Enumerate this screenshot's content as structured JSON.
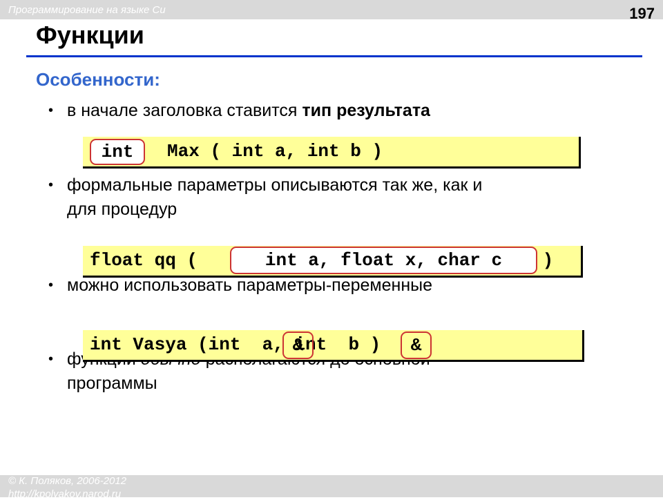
{
  "header": {
    "course": "Программирование на языке Си",
    "page_number": "197"
  },
  "title": "Функции",
  "subtitle": "Особенности:",
  "bullets": [
    {
      "text": "в начале заголовка ставится ",
      "bold": "тип результата"
    },
    {
      "line1": "формальные параметры описываются так же, как и",
      "line2": "для процедур"
    },
    {
      "text": "можно использовать параметры-переменные"
    },
    {
      "line1_start": "функции ",
      "line1_italic": "обычно",
      "line1_end": " располагаются до основной",
      "line2": "программы"
    }
  ],
  "code": {
    "box1": {
      "highlight": "int",
      "rest": "Max ( int a, int b )"
    },
    "box2": {
      "start": "float qq ( ",
      "highlight": "int a, float x, char c",
      "end": " )"
    },
    "box3": {
      "text": "int Vasya (int  a, int  b )",
      "amp1": "&",
      "amp2": "&"
    }
  },
  "colors": {
    "accent": "#3366cc",
    "rule": "#0033cc",
    "code_bg": "#ffff99",
    "highlight_border": "#cc3333",
    "bar": "#d9d9d9"
  },
  "footer": {
    "author": "© К. Поляков, 2006-2012",
    "site": "http://kpolyakov.narod.ru"
  }
}
